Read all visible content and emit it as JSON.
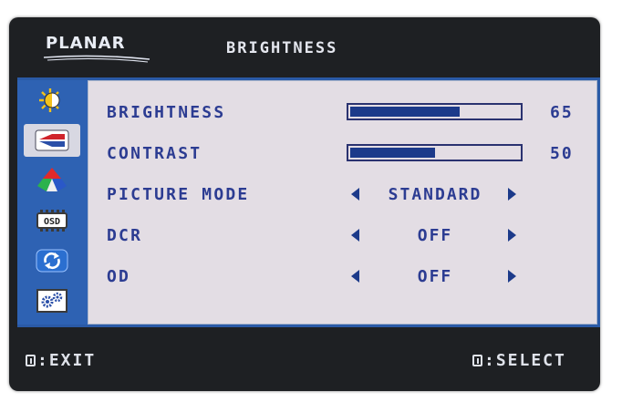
{
  "header": {
    "brand": "PLANAR",
    "title": "BRIGHTNESS"
  },
  "sidebar": {
    "items": [
      {
        "icon": "brightness-icon",
        "active": false
      },
      {
        "icon": "image-adjust-icon",
        "active": true
      },
      {
        "icon": "color-icon",
        "active": false
      },
      {
        "icon": "osd-icon",
        "active": false
      },
      {
        "icon": "reset-icon",
        "active": false
      },
      {
        "icon": "settings-icon",
        "active": false
      }
    ]
  },
  "menu": {
    "brightness": {
      "label": "BRIGHTNESS",
      "value": "65",
      "level": 65
    },
    "contrast": {
      "label": "CONTRAST",
      "value": "50",
      "level": 50
    },
    "picture_mode": {
      "label": "PICTURE MODE",
      "value": "STANDARD"
    },
    "dcr": {
      "label": "DCR",
      "value": "OFF"
    },
    "od": {
      "label": "OD",
      "value": "OFF"
    }
  },
  "footer": {
    "exit": ":EXIT",
    "select": ":SELECT"
  },
  "colors": {
    "bezel": "#1e2023",
    "frame": "#2a5aa6",
    "panel": "#e3dde4",
    "text": "#2c3c92",
    "bar_fill": "#1c3a8a"
  }
}
